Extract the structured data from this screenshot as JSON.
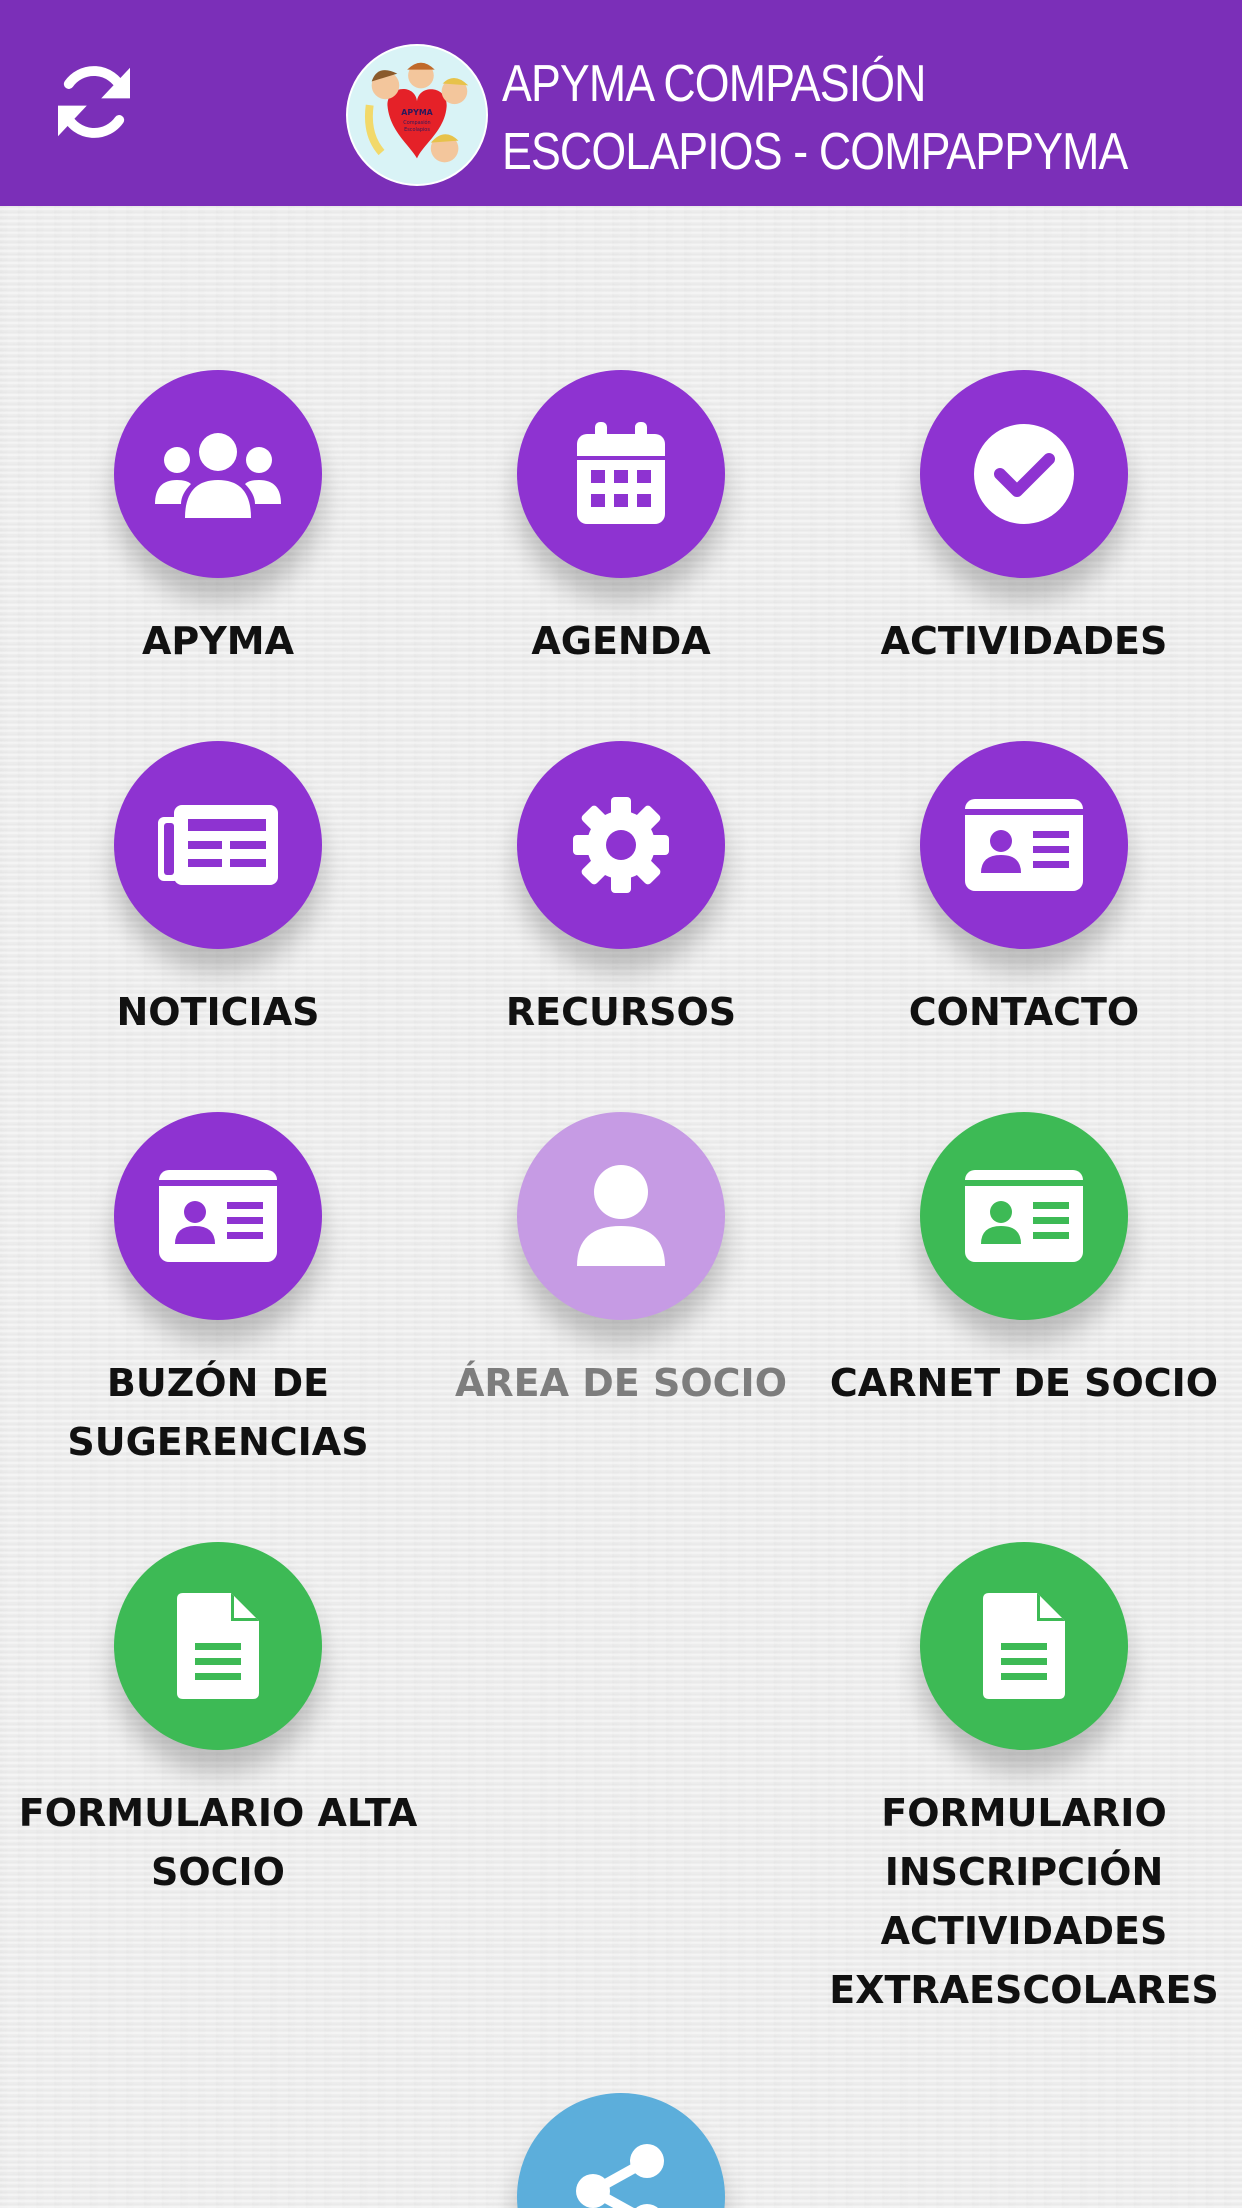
{
  "header": {
    "title_line1": "APYMA COMPASIÓN",
    "title_line2": "ESCOLAPIOS - COMPAPPYMA",
    "refresh_icon": "sync-icon",
    "logo_text": "APYMA Compasión Escolapios"
  },
  "colors": {
    "header": "#7b2fb8",
    "primary": "#8e33d1",
    "disabled": "#c69be4",
    "green": "#3dba55",
    "share": "#5caedb"
  },
  "tiles": [
    {
      "label": "APYMA",
      "icon": "users-icon",
      "color": "purple"
    },
    {
      "label": "AGENDA",
      "icon": "calendar-icon",
      "color": "purple"
    },
    {
      "label": "ACTIVIDADES",
      "icon": "check-circle-icon",
      "color": "purple"
    },
    {
      "label": "NOTICIAS",
      "icon": "newspaper-icon",
      "color": "purple"
    },
    {
      "label": "RECURSOS",
      "icon": "gear-icon",
      "color": "purple"
    },
    {
      "label": "CONTACTO",
      "icon": "id-card-icon",
      "color": "purple"
    },
    {
      "label": "BUZÓN DE SUGERENCIAS",
      "icon": "id-card-icon",
      "color": "purple"
    },
    {
      "label": "ÁREA DE SOCIO",
      "icon": "user-icon",
      "color": "lavender",
      "disabled": true
    },
    {
      "label": "CARNET DE SOCIO",
      "icon": "id-card-icon",
      "color": "green"
    },
    {
      "label": "FORMULARIO ALTA SOCIO",
      "icon": "document-icon",
      "color": "green"
    },
    {
      "label": "FORMULARIO INSCRIPCIÓN ACTIVIDADES EXTRAESCOLARES",
      "icon": "document-icon",
      "color": "green"
    },
    {
      "label": "",
      "icon": "share-icon",
      "color": "blue"
    }
  ]
}
